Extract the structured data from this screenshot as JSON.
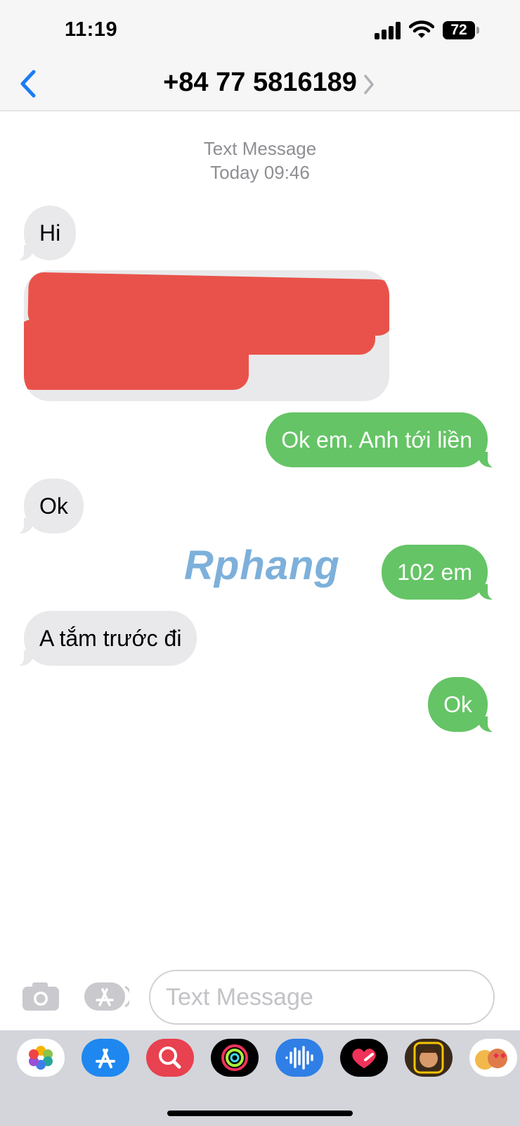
{
  "status_bar": {
    "time": "11:19",
    "battery": "72",
    "signal_icon": "cellular-signal-icon",
    "wifi_icon": "wifi-icon"
  },
  "nav": {
    "title": "+84 77 5816189",
    "back_icon": "chevron-left-icon",
    "detail_icon": "chevron-right-icon"
  },
  "thread": {
    "service_label": "Text Message",
    "timestamp": "Today 09:46",
    "messages": [
      {
        "from": "them",
        "text": "Hi"
      },
      {
        "from": "them",
        "text": "",
        "redacted": true
      },
      {
        "from": "me",
        "text": "Ok em. Anh tới liền"
      },
      {
        "from": "them",
        "text": "Ok"
      },
      {
        "from": "me",
        "text": "102 em"
      },
      {
        "from": "them",
        "text": "A tắm trước đi"
      },
      {
        "from": "me",
        "text": "Ok"
      }
    ]
  },
  "watermark": "Rphang",
  "composer": {
    "placeholder": "Text Message",
    "camera_icon": "camera-icon",
    "apps_icon": "app-store-icon"
  },
  "app_drawer": {
    "apps": [
      "photos-icon",
      "app-store-icon",
      "image-search-icon",
      "activity-icon",
      "audio-message-icon",
      "digital-touch-icon",
      "memoji-icon",
      "memoji-stickers-icon"
    ]
  },
  "colors": {
    "incoming_bubble": "#e9e9eb",
    "outgoing_bubble": "#65c466",
    "accent": "#1a7cf5",
    "redaction": "#e9524a"
  }
}
